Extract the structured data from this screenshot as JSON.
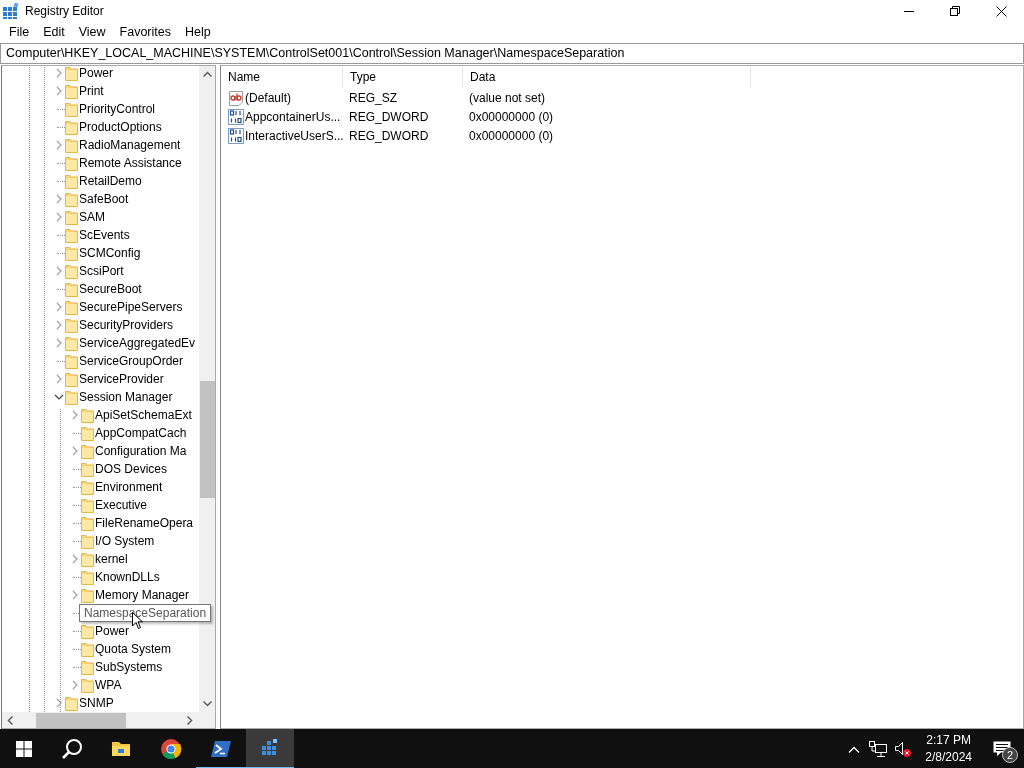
{
  "window": {
    "title": "Registry Editor"
  },
  "menu": [
    "File",
    "Edit",
    "View",
    "Favorites",
    "Help"
  ],
  "address": "Computer\\HKEY_LOCAL_MACHINE\\SYSTEM\\ControlSet001\\Control\\Session Manager\\NamespaceSeparation",
  "tree": {
    "items": [
      {
        "label": "Power",
        "kind": "branch",
        "expanded": false
      },
      {
        "label": "Print",
        "kind": "branch",
        "expanded": false
      },
      {
        "label": "PriorityControl",
        "kind": "leaf"
      },
      {
        "label": "ProductOptions",
        "kind": "leaf"
      },
      {
        "label": "RadioManagement",
        "kind": "branch",
        "expanded": false
      },
      {
        "label": "Remote Assistance",
        "kind": "leaf"
      },
      {
        "label": "RetailDemo",
        "kind": "leaf"
      },
      {
        "label": "SafeBoot",
        "kind": "branch",
        "expanded": false
      },
      {
        "label": "SAM",
        "kind": "branch",
        "expanded": false
      },
      {
        "label": "ScEvents",
        "kind": "leaf"
      },
      {
        "label": "SCMConfig",
        "kind": "leaf"
      },
      {
        "label": "ScsiPort",
        "kind": "branch",
        "expanded": false
      },
      {
        "label": "SecureBoot",
        "kind": "leaf"
      },
      {
        "label": "SecurePipeServers",
        "kind": "branch",
        "expanded": false
      },
      {
        "label": "SecurityProviders",
        "kind": "branch",
        "expanded": false
      },
      {
        "label": "ServiceAggregatedEv",
        "kind": "branch",
        "expanded": false
      },
      {
        "label": "ServiceGroupOrder",
        "kind": "leaf"
      },
      {
        "label": "ServiceProvider",
        "kind": "branch",
        "expanded": false
      },
      {
        "label": "Session Manager",
        "kind": "branch",
        "expanded": true,
        "children": [
          {
            "label": "ApiSetSchemaExt",
            "kind": "branch",
            "expanded": false
          },
          {
            "label": "AppCompatCach",
            "kind": "leaf"
          },
          {
            "label": "Configuration Ma",
            "kind": "branch",
            "expanded": false
          },
          {
            "label": "DOS Devices",
            "kind": "leaf"
          },
          {
            "label": "Environment",
            "kind": "leaf"
          },
          {
            "label": "Executive",
            "kind": "leaf"
          },
          {
            "label": "FileRenameOpera",
            "kind": "leaf"
          },
          {
            "label": "I/O System",
            "kind": "leaf"
          },
          {
            "label": "kernel",
            "kind": "branch",
            "expanded": false
          },
          {
            "label": "KnownDLLs",
            "kind": "leaf"
          },
          {
            "label": "Memory Manager",
            "kind": "branch",
            "expanded": false
          },
          {
            "label": "NamespaceSeparation",
            "kind": "leaf",
            "tooltip": true
          },
          {
            "label": "Power",
            "kind": "leaf"
          },
          {
            "label": "Quota System",
            "kind": "leaf"
          },
          {
            "label": "SubSystems",
            "kind": "leaf"
          },
          {
            "label": "WPA",
            "kind": "branch",
            "expanded": false
          }
        ]
      },
      {
        "label": "SNMP",
        "kind": "branch",
        "expanded": false
      }
    ]
  },
  "table": {
    "columns": [
      "Name",
      "Type",
      "Data"
    ],
    "rows": [
      {
        "kind": "string",
        "name": "(Default)",
        "type": "REG_SZ",
        "data": "(value not set)"
      },
      {
        "kind": "dword",
        "name": "AppcontainerUs...",
        "type": "REG_DWORD",
        "data": "0x00000000 (0)"
      },
      {
        "kind": "dword",
        "name": "InteractiveUserS...",
        "type": "REG_DWORD",
        "data": "0x00000000 (0)"
      }
    ]
  },
  "taskbar": {
    "apps": [
      {
        "kind": "explorer",
        "running": false,
        "active": false
      },
      {
        "kind": "chrome",
        "running": false,
        "active": false
      },
      {
        "kind": "powershell",
        "running": true,
        "active": false
      },
      {
        "kind": "regedit",
        "running": true,
        "active": true
      }
    ],
    "time": "2:17 PM",
    "date": "2/8/2024",
    "notifications": "2"
  }
}
